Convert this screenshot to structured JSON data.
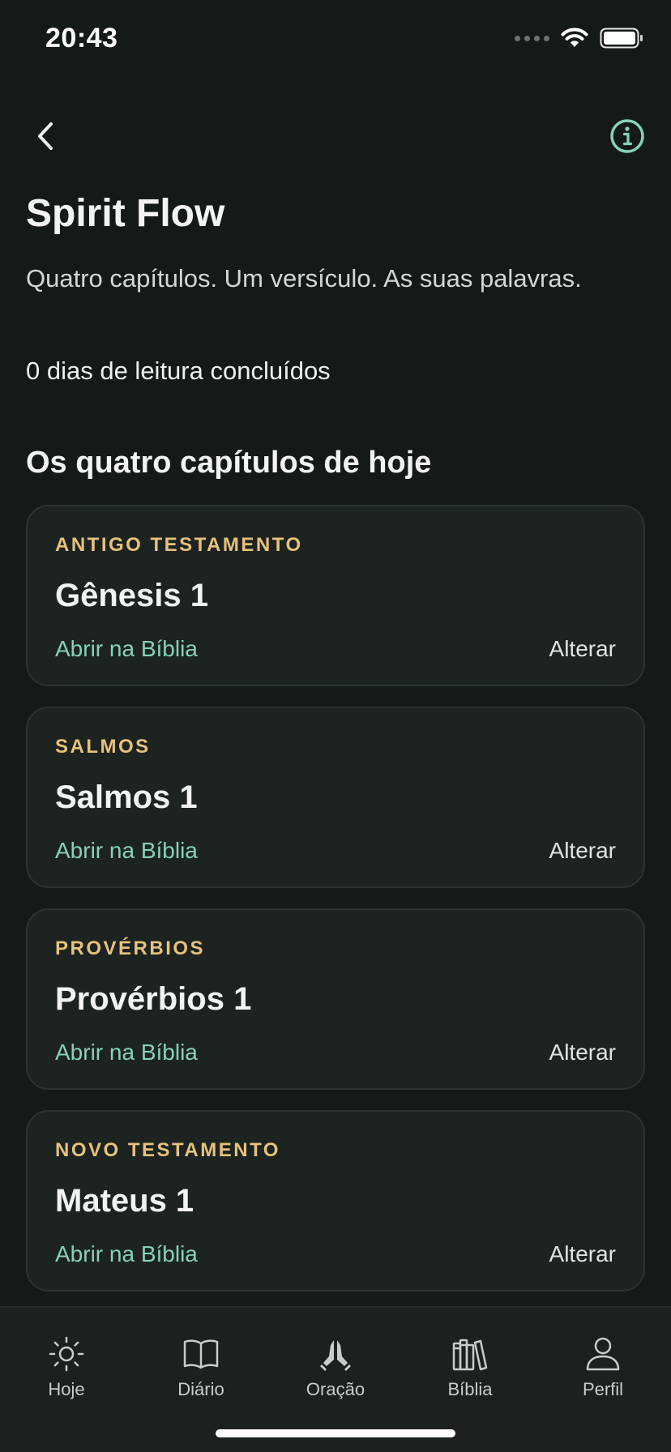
{
  "status_bar": {
    "time": "20:43"
  },
  "header": {
    "title": "Spirit Flow",
    "subtitle": "Quatro capítulos. Um versículo. As suas palavras.",
    "streak": "0 dias de leitura concluídos",
    "section_title": "Os quatro capítulos de hoje"
  },
  "cards": [
    {
      "category": "ANTIGO TESTAMENTO",
      "chapter": "Gênesis 1",
      "open_label": "Abrir na Bíblia",
      "change_label": "Alterar"
    },
    {
      "category": "SALMOS",
      "chapter": "Salmos 1",
      "open_label": "Abrir na Bíblia",
      "change_label": "Alterar"
    },
    {
      "category": "PROVÉRBIOS",
      "chapter": "Provérbios 1",
      "open_label": "Abrir na Bíblia",
      "change_label": "Alterar"
    },
    {
      "category": "NOVO TESTAMENTO",
      "chapter": "Mateus 1",
      "open_label": "Abrir na Bíblia",
      "change_label": "Alterar"
    }
  ],
  "tabs": [
    {
      "label": "Hoje",
      "icon": "sun-icon"
    },
    {
      "label": "Diário",
      "icon": "open-book-icon"
    },
    {
      "label": "Oração",
      "icon": "praying-hands-icon"
    },
    {
      "label": "Bíblia",
      "icon": "books-icon"
    },
    {
      "label": "Perfil",
      "icon": "person-icon"
    }
  ],
  "colors": {
    "background": "#141a17",
    "card": "#1d2320",
    "accent_green": "#86d2b8",
    "category_gold": "#e7c27c"
  }
}
